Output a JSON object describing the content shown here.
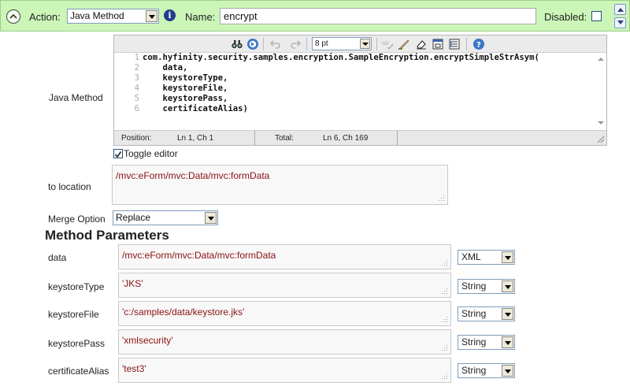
{
  "header": {
    "action_label": "Action:",
    "action_value": "Java Method",
    "name_label": "Name:",
    "name_value": "encrypt",
    "disabled_label": "Disabled:"
  },
  "java_method": {
    "label": "Java Method",
    "font_size": "8 pt",
    "code_lines": [
      {
        "n": "1",
        "text": "com.hyfinity.security.samples.encryption.SampleEncryption.encryptSimpleStrAsym("
      },
      {
        "n": "2",
        "text": "    data,"
      },
      {
        "n": "3",
        "text": "    keystoreType,"
      },
      {
        "n": "4",
        "text": "    keystoreFile,"
      },
      {
        "n": "5",
        "text": "    keystorePass,"
      },
      {
        "n": "6",
        "text": "    certificateAlias)"
      }
    ],
    "status": {
      "position_label": "Position:",
      "position_value": "Ln 1, Ch 1",
      "total_label": "Total:",
      "total_value": "Ln 6, Ch 169"
    },
    "toggle_label": "Toggle editor"
  },
  "to_location": {
    "label": "to location",
    "value": "/mvc:eForm/mvc:Data/mvc:formData"
  },
  "merge": {
    "label": "Merge Option",
    "value": "Replace"
  },
  "method_parameters": {
    "title": "Method Parameters",
    "params": [
      {
        "label": "data",
        "value": "/mvc:eForm/mvc:Data/mvc:formData",
        "type": "XML"
      },
      {
        "label": "keystoreType",
        "value": "'JKS'",
        "type": "String"
      },
      {
        "label": "keystoreFile",
        "value": "'c:/samples/data/keystore.jks'",
        "type": "String"
      },
      {
        "label": "keystorePass",
        "value": "'xmlsecurity'",
        "type": "String"
      },
      {
        "label": "certificateAlias",
        "value": "'test3'",
        "type": "String"
      }
    ]
  },
  "colors": {
    "header_bg": "#ccf5b8",
    "value_text": "#8b1010"
  }
}
